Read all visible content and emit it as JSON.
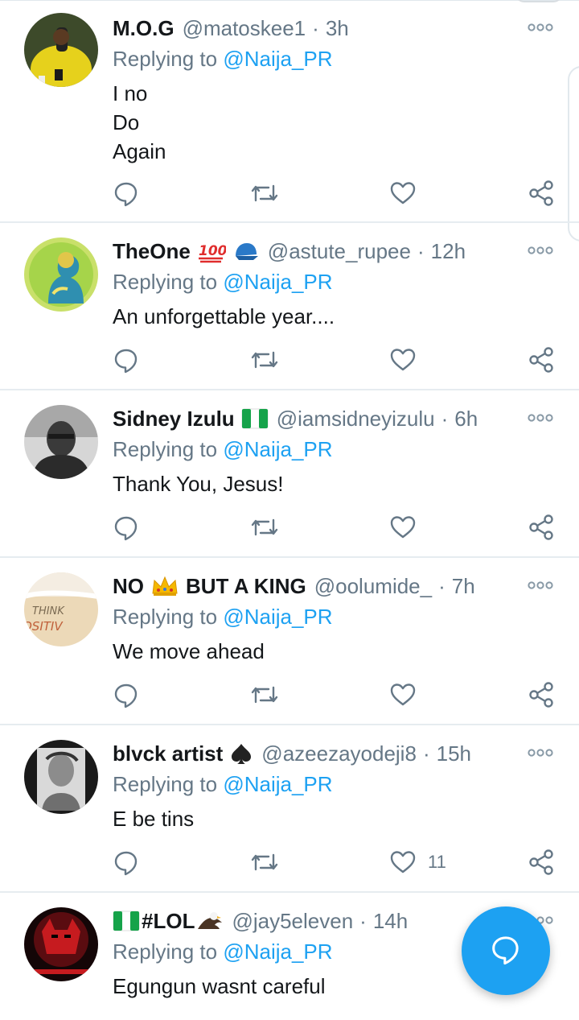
{
  "colors": {
    "accent": "#1da1f2",
    "muted": "#657786",
    "text": "#14171a",
    "divider": "#e6ecf0"
  },
  "replying_prefix": "Replying to",
  "tweets": [
    {
      "name": "M.O.G",
      "handle": "@matoskee1",
      "time": "3h",
      "reply_to": "@Naija_PR",
      "lines": [
        "I no",
        "Do",
        "Again"
      ],
      "like_count": "",
      "avatar": "yellow-shirt-selfie"
    },
    {
      "name": "TheOne",
      "emojis": [
        "hundred-points-emoji",
        "blue-cap-emoji"
      ],
      "handle": "@astute_rupee",
      "time": "12h",
      "reply_to": "@Naija_PR",
      "lines": [
        "An unforgettable year...."
      ],
      "like_count": "",
      "avatar": "green-silhouette-art"
    },
    {
      "name": "Sidney Izulu",
      "emojis": [
        "nigeria-flag-emoji"
      ],
      "handle": "@iamsidneyizulu",
      "time": "6h",
      "reply_to": "@Naija_PR",
      "lines": [
        "Thank You, Jesus!"
      ],
      "like_count": "",
      "avatar": "grayscale-portrait"
    },
    {
      "name_a": "NO",
      "name_b": "BUT A KING",
      "emojis": [
        "crown-emoji"
      ],
      "handle": "@oolumide_",
      "time": "7h",
      "reply_to": "@Naija_PR",
      "lines": [
        "We move ahead"
      ],
      "like_count": "",
      "avatar": "think-positive-sand",
      "avatar_text_1": "THINK",
      "avatar_text_2": "OSITIV"
    },
    {
      "name": "blvck artist",
      "emojis": [
        "spade-emoji"
      ],
      "handle": "@azeezayodeji8",
      "time": "15h",
      "reply_to": "@Naija_PR",
      "lines": [
        "E be tins"
      ],
      "like_count": "11",
      "avatar": "sketch-portrait"
    },
    {
      "name": "#LOL",
      "emojis": [
        "nigeria-flag-emoji",
        "eagle-emoji"
      ],
      "handle": "@jay5eleven",
      "time": "14h",
      "reply_to": "@Naija_PR",
      "lines": [
        "Egungun wasnt careful"
      ],
      "like_count": "",
      "avatar": "red-dark-figure"
    }
  ],
  "icons": {
    "reply": "reply-icon",
    "retweet": "retweet-icon",
    "like": "like-icon",
    "share": "share-icon",
    "more": "more-options-icon",
    "compose": "compose-reply-icon"
  }
}
